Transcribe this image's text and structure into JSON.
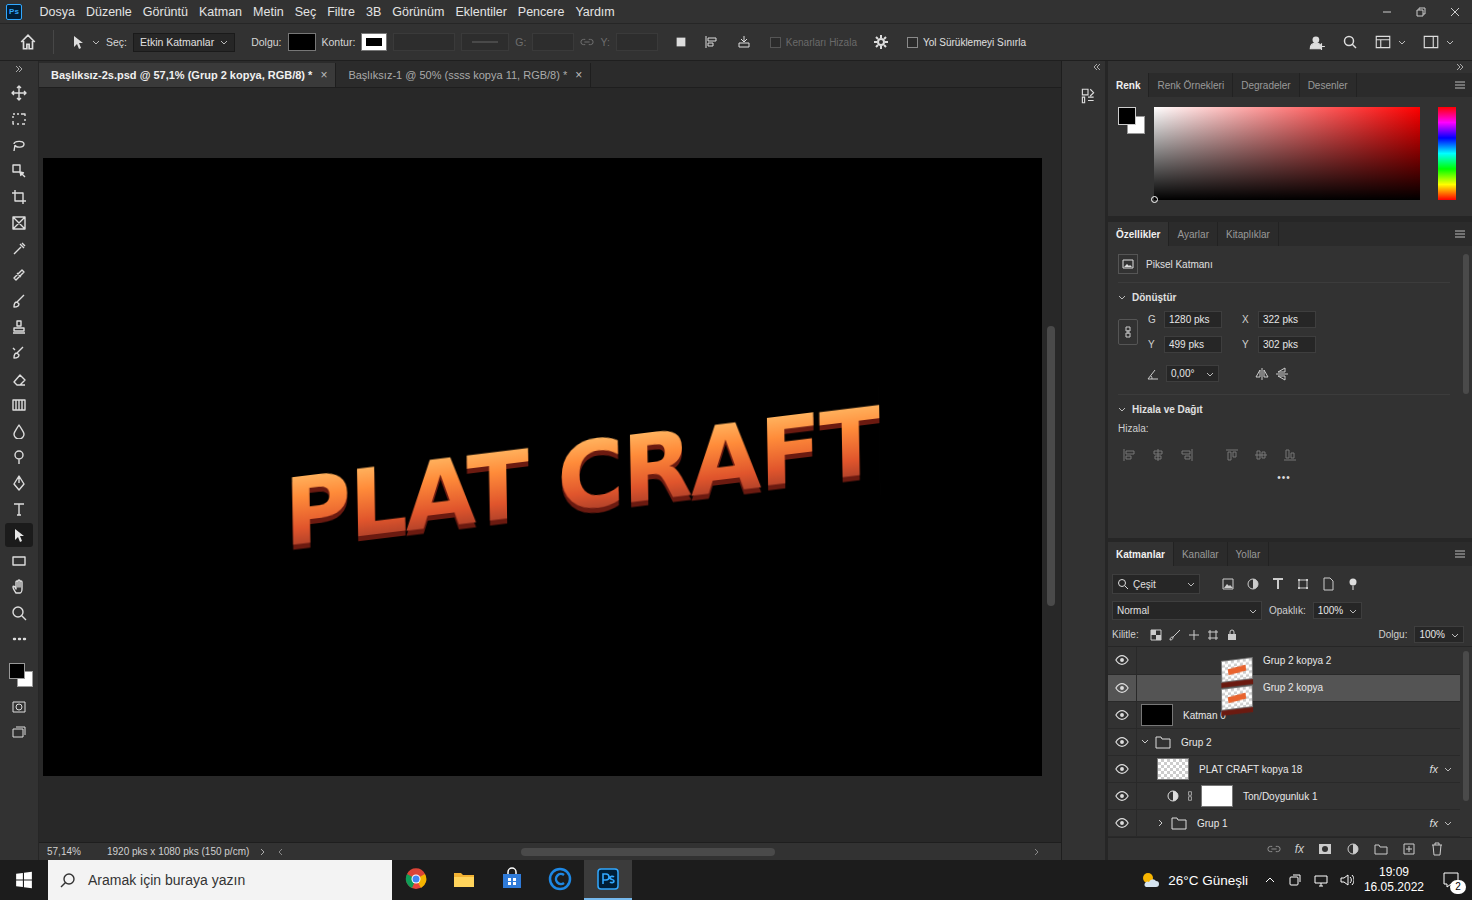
{
  "app": {
    "logo": "Ps"
  },
  "menu": [
    "Dosya",
    "Düzenle",
    "Görüntü",
    "Katman",
    "Metin",
    "Seç",
    "Filtre",
    "3B",
    "Görünüm",
    "Eklentiler",
    "Pencere",
    "Yardım"
  ],
  "options_bar": {
    "select_label": "Seç:",
    "select_value": "Etkin Katmanlar",
    "fill_label": "Dolgu:",
    "stroke_label": "Kontur:",
    "w_label": "G:",
    "h_label": "Y:",
    "align_edges": {
      "label": "Kenarları Hizala",
      "checked": false,
      "disabled": true
    },
    "constrain_path": {
      "label": "Yol Sürüklemeyi Sınırla",
      "checked": false,
      "disabled": false
    }
  },
  "toolbar": {
    "tools": [
      {
        "selected": false
      },
      {
        "selected": false
      },
      {
        "selected": false
      },
      {
        "selected": false
      },
      {
        "selected": false
      },
      {
        "selected": false
      },
      {
        "selected": false
      },
      {
        "selected": false
      },
      {
        "selected": false
      },
      {
        "selected": false
      },
      {
        "selected": false
      },
      {
        "selected": false
      },
      {
        "selected": false
      },
      {
        "selected": false
      },
      {
        "selected": false
      },
      {
        "selected": false
      },
      {
        "selected": false
      },
      {
        "selected": true
      },
      {
        "selected": false
      },
      {
        "selected": false
      },
      {
        "selected": false
      },
      {
        "selected": false
      }
    ],
    "foreground_color": "#000000",
    "background_color": "#ffffff"
  },
  "document_tabs": [
    {
      "label": "Başlıksız-2s.psd @ 57,1% (Grup 2 kopya, RGB/8) *",
      "close": "×",
      "selected": true
    },
    {
      "label": "Başlıksız-1 @ 50% (ssss kopya 11, RGB/8) *",
      "close": "×",
      "selected": false
    }
  ],
  "canvas": {
    "artwork": "PLAT CRAFT"
  },
  "status_bar": {
    "zoom": "57,14%",
    "info": "1920 pks x 1080 pks (150 p/cm)"
  },
  "color_panel": {
    "tabs": [
      {
        "label": "Renk",
        "selected": true
      },
      {
        "label": "Renk Örnekleri",
        "selected": false
      },
      {
        "label": "Degradeler",
        "selected": false
      },
      {
        "label": "Desenler",
        "selected": false
      }
    ]
  },
  "properties_panel": {
    "tabs": [
      {
        "label": "Özellikler",
        "selected": true
      },
      {
        "label": "Ayarlar",
        "selected": false
      },
      {
        "label": "Kitaplıklar",
        "selected": false
      }
    ],
    "layer_kind": "Piksel Katmanı",
    "transform": {
      "title": "Dönüştür",
      "expanded": true,
      "rows": [
        [
          {
            "label": "G",
            "value": "1280 pks"
          },
          {
            "label": "X",
            "value": "322 pks"
          }
        ],
        [
          {
            "label": "Y",
            "value": "499 pks"
          },
          {
            "label": "Y",
            "value": "302 pks"
          }
        ]
      ],
      "angle": "0,00°"
    },
    "align": {
      "title": "Hizala ve Dağıt",
      "expanded": true,
      "label": "Hizala:",
      "more": "•••"
    }
  },
  "layers_panel": {
    "tabs": [
      {
        "label": "Katmanlar",
        "selected": true
      },
      {
        "label": "Kanallar",
        "selected": false
      },
      {
        "label": "Yollar",
        "selected": false
      }
    ],
    "filter": "Çeşit",
    "blend_mode": "Normal",
    "opacity_label": "Opaklık:",
    "opacity": "100%",
    "lock_label": "Kilitle:",
    "fill_label": "Dolgu:",
    "fill": "100%",
    "layers": [
      {
        "name": "Grup 2 kopya 2",
        "kind": "artwork",
        "depth": 0,
        "visible": true,
        "selected": false,
        "expanded": false,
        "badge": ""
      },
      {
        "name": "Grup 2 kopya",
        "kind": "artwork",
        "depth": 0,
        "visible": true,
        "selected": true,
        "expanded": false,
        "badge": ""
      },
      {
        "name": "Katman 0",
        "kind": "solid",
        "depth": 0,
        "visible": true,
        "selected": false,
        "expanded": false,
        "badge": ""
      },
      {
        "name": "Grup 2",
        "kind": "group",
        "depth": 0,
        "visible": true,
        "selected": false,
        "expanded": true,
        "badge": ""
      },
      {
        "name": "PLAT CRAFT kopya 18",
        "kind": "transparent",
        "depth": 1,
        "visible": true,
        "selected": false,
        "expanded": false,
        "badge": "fx"
      },
      {
        "name": "Ton/Doygunluk 1",
        "kind": "adjustment",
        "depth": 1,
        "visible": true,
        "selected": false,
        "expanded": false,
        "badge": ""
      },
      {
        "name": "Grup 1",
        "kind": "group",
        "depth": 1,
        "visible": true,
        "selected": false,
        "expanded": false,
        "badge": "fx"
      }
    ],
    "footer_effects": "fx"
  },
  "taskbar": {
    "search_placeholder": "Aramak için buraya yazın",
    "weather": "26°C Güneşli",
    "time": "19:09",
    "date": "16.05.2022",
    "notifications": "2",
    "apps": [
      {
        "selected": false
      },
      {
        "selected": false
      },
      {
        "selected": false
      },
      {
        "selected": false
      },
      {
        "selected": true
      }
    ]
  }
}
